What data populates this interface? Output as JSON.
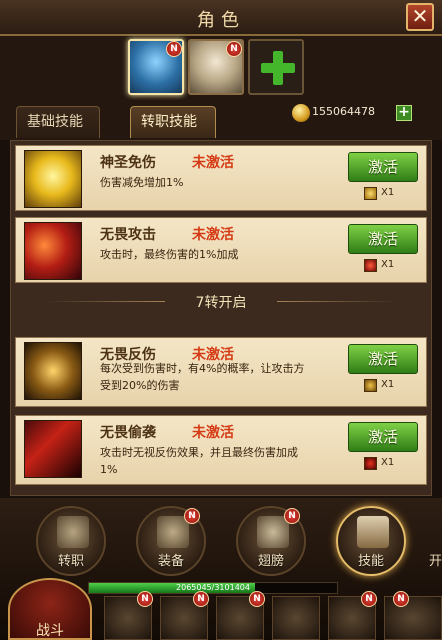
{
  "window": {
    "title": "角色",
    "close_label": "✕"
  },
  "heroes": [
    {
      "name": "hero-portrait-1",
      "badge": "N",
      "selected": true
    },
    {
      "name": "hero-portrait-2",
      "badge": "N",
      "selected": false
    }
  ],
  "add_hero_icon": "plus-icon",
  "tabs": [
    {
      "label": "基础技能",
      "active": false
    },
    {
      "label": "转职技能",
      "active": true
    }
  ],
  "currency": {
    "gold": "155064478",
    "add_label": "+"
  },
  "skills": [
    {
      "name": "神圣免伤",
      "state": "未激活",
      "desc": "伤害减免增加1%",
      "button": "激活",
      "cost_icon": "shield-token-icon",
      "cost": "X1"
    },
    {
      "name": "无畏攻击",
      "state": "未激活",
      "desc": "攻击时，最终伤害的1%加成",
      "button": "激活",
      "cost_icon": "axe-token-icon",
      "cost": "X1"
    },
    {
      "name": "无畏反伤",
      "state": "未激活",
      "desc": "每次受到伤害时，有4%的概率，让攻击方受到20%的伤害",
      "button": "激活",
      "cost_icon": "gear-token-icon",
      "cost": "X1"
    },
    {
      "name": "无畏偷袭",
      "state": "未激活",
      "desc": "攻击时无视反伤效果，并且最终伤害加成1%",
      "button": "激活",
      "cost_icon": "claw-token-icon",
      "cost": "X1"
    }
  ],
  "tier_divider": "7转开启",
  "bottom_nav": [
    {
      "label": "转职",
      "badge": ""
    },
    {
      "label": "装备",
      "badge": "N"
    },
    {
      "label": "翅膀",
      "badge": "N"
    },
    {
      "label": "技能",
      "badge": ""
    }
  ],
  "edge_text": "开",
  "hp": {
    "text": "2065045/3101404",
    "fill_fraction": 0.67
  },
  "battle": {
    "label": "战斗"
  },
  "slots": [
    {
      "badge": "N",
      "label": ""
    },
    {
      "badge": "N",
      "label": ""
    },
    {
      "badge": "N",
      "label": ""
    },
    {
      "badge": "",
      "label": ""
    },
    {
      "badge": "N",
      "label": ""
    },
    {
      "badge": "N",
      "label": ""
    }
  ],
  "colors": {
    "accent_green": "#43b62b",
    "state_red": "#d53b15",
    "badge_red": "#e8463a",
    "frame_gold": "#e4bc6a"
  }
}
